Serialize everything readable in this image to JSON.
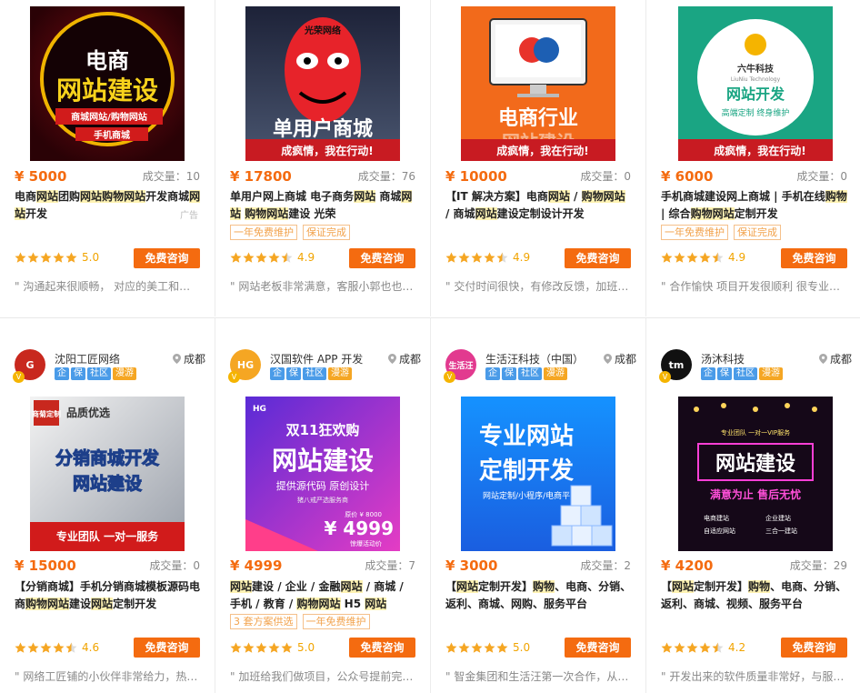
{
  "cards": [
    {
      "price": "¥ 5000",
      "sales": "成交量：10",
      "title_parts": [
        [
          "电商",
          ""
        ],
        [
          "网站",
          "hl"
        ],
        [
          "团购",
          ""
        ],
        [
          "网站",
          "hl"
        ],
        [
          "购物网站",
          "hl"
        ],
        [
          "开发商城",
          ""
        ],
        [
          "网",
          "hl"
        ],
        [
          "站",
          "hl"
        ],
        [
          "开发",
          ""
        ]
      ],
      "ad": "广告",
      "chips": [],
      "stars": 5,
      "score": "5.0",
      "consult": "免费咨询",
      "review": "\" 沟通起来很顺畅， 对应的美工和技术团队都很专业",
      "thumb": {
        "line1": "电商",
        "line2": "网站建设",
        "line3": "商城网站/购物网站",
        "line4": "手机商城"
      }
    },
    {
      "price": "¥ 17800",
      "sales": "成交量：76",
      "title_parts": [
        [
          "单用户网上商城 电子商务",
          ""
        ],
        [
          "网站",
          "hl"
        ],
        [
          " 商城",
          ""
        ],
        [
          "网",
          "hl"
        ],
        [
          "站",
          "hl"
        ],
        [
          " ",
          ""
        ],
        [
          "购物网站",
          "hl"
        ],
        [
          "建设 光荣",
          ""
        ]
      ],
      "chips": [
        "一年免费维护",
        "保证完成"
      ],
      "stars": 4.5,
      "score": "4.9",
      "consult": "免费咨询",
      "review": "\" 网站老板非常满意，客服小郭也也很耐心",
      "thumb": {
        "line1": "单用户商城",
        "banner": "成疯情，我在行动!",
        "mask_text": "光荣网络"
      }
    },
    {
      "price": "¥ 10000",
      "sales": "成交量：0",
      "title_parts": [
        [
          "【IT 解决方案】电商",
          ""
        ],
        [
          "网站",
          "hl"
        ],
        [
          " / ",
          ""
        ],
        [
          "购物网站",
          "hl"
        ],
        [
          " / 商城",
          ""
        ],
        [
          "网站",
          "hl"
        ],
        [
          "建设定制设计开发",
          ""
        ]
      ],
      "chips": [],
      "stars": 4.5,
      "score": "4.9",
      "consult": "免费咨询",
      "review": "\" 交付时间很快，有修改反馈，加班加点完成",
      "thumb": {
        "line1": "电商行业",
        "line2": "网站建设",
        "banner": "成疯情，我在行动!"
      }
    },
    {
      "price": "¥ 6000",
      "sales": "成交量：0",
      "title_parts": [
        [
          "手机商城建设网上商城 | 手机在线",
          ""
        ],
        [
          "购物",
          "hl"
        ],
        [
          " | 综合",
          ""
        ],
        [
          "购物网站",
          "hl"
        ],
        [
          "定制开发",
          ""
        ]
      ],
      "chips": [
        "一年免费维护",
        "保证完成"
      ],
      "stars": 4.5,
      "score": "4.9",
      "consult": "免费咨询",
      "review": "\" 合作愉快 项目开发很顺利 很专业的团队",
      "thumb": {
        "brand": "六牛科技",
        "brand_en": "LiuNiu Technology",
        "line1": "网站开发",
        "line2": "高端定制  终身维护",
        "banner": "成疯情，我在行动!"
      }
    },
    {
      "shop_name": "沈阳工匠网络",
      "location": "成都",
      "logo_text": "G",
      "logo_color": "#c8281e",
      "price": "¥ 15000",
      "sales": "成交量：0",
      "title_parts": [
        [
          "【分销商城】手机分销商城模板源码电商",
          ""
        ],
        [
          "购物网站",
          "hl"
        ],
        [
          "建设",
          ""
        ],
        [
          "网站",
          "hl"
        ],
        [
          "定制开发",
          ""
        ]
      ],
      "chips": [],
      "stars": 4.5,
      "score": "4.6",
      "consult": "免费咨询",
      "review": "\" 网络工匠铺的小伙伴非常给力，热情耐心",
      "thumb": {
        "badge": "商菊定制",
        "line0": "品质优选",
        "line1": "分销商城开发",
        "line2": "网站建设",
        "line3": "专业团队  一对一服务"
      }
    },
    {
      "shop_name": "汉国软件 APP 开发",
      "location": "成都",
      "logo_text": "HG",
      "logo_color": "#f5a623",
      "price": "¥ 4999",
      "sales": "成交量：7",
      "title_parts": [
        [
          "网站",
          "hl"
        ],
        [
          "建设 / 企业 / 金融",
          ""
        ],
        [
          "网站",
          "hl"
        ],
        [
          " / 商城 / 手机 / 教育 / ",
          ""
        ],
        [
          "购物网站",
          "hl"
        ],
        [
          " H5 ",
          ""
        ],
        [
          "网站",
          "hl"
        ]
      ],
      "chips": [
        "3 套方案供选",
        "一年免费维护"
      ],
      "stars": 5,
      "score": "5.0",
      "consult": "免费咨询",
      "review": "\" 加班给我们做项目，公众号提前完成了",
      "thumb": {
        "logo": "HG",
        "line0": "双11狂欢购",
        "line1": "网站建设",
        "line2": "提供源代码  原创设计",
        "line3": "猪八戒严选服务商",
        "old": "原价 ¥ 8000",
        "now": "¥ 4999",
        "note": "惊爆活动价"
      }
    },
    {
      "shop_name": "生活汪科技（中国）",
      "location": "成都",
      "logo_text": "生活汪",
      "logo_color": "#e23a8f",
      "price": "¥ 3000",
      "sales": "成交量：2",
      "title_parts": [
        [
          "【",
          ""
        ],
        [
          "网站",
          "hl"
        ],
        [
          "定制开发】",
          ""
        ],
        [
          "购物",
          "hl"
        ],
        [
          "、电商、分销、返利、商城、网购、服务平台",
          ""
        ]
      ],
      "chips": [],
      "stars": 5,
      "score": "5.0",
      "consult": "免费咨询",
      "review": "\" 智金集团和生活汪第一次合作，从开始到",
      "thumb": {
        "line1": "专业网站",
        "line2": "定制开发",
        "line3": "网站定制/小程序/电商平台"
      }
    },
    {
      "shop_name": "汤沐科技",
      "location": "成都",
      "logo_text": "tm",
      "logo_color": "#111",
      "price": "¥ 4200",
      "sales": "成交量：29",
      "title_parts": [
        [
          "【",
          ""
        ],
        [
          "网站",
          "hl"
        ],
        [
          "定制开发】",
          ""
        ],
        [
          "购物",
          "hl"
        ],
        [
          "、电商、分销、返利、商城、视频、服务平台",
          ""
        ]
      ],
      "chips": [],
      "stars": 4.5,
      "score": "4.2",
      "consult": "免费咨询",
      "review": "\" 开发出来的软件质量非常好，与服务描述",
      "thumb": {
        "top": "专业团队 一对一VIP服务",
        "line1": "网站建设",
        "line2": "满意为止  售后无忧",
        "items": [
          "电商建站",
          "企业建站",
          "自适应网站",
          "三合一建站"
        ]
      }
    }
  ],
  "shop_tags": [
    "企",
    "保",
    "社区",
    "漫游"
  ]
}
